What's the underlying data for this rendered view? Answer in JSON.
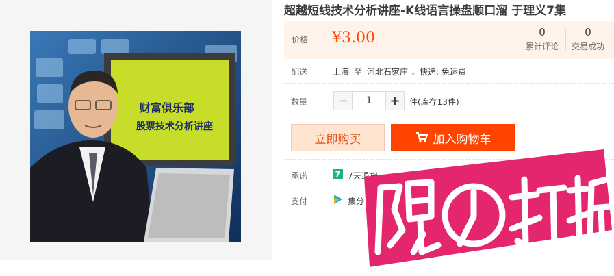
{
  "product": {
    "title": "超越短线技术分析讲座-K线语言操盘顺口溜 于理义7集",
    "image_board_line1": "财富俱乐部",
    "image_board_line2": "股票技术分析讲座"
  },
  "price": {
    "label": "价格",
    "value": "¥3.00"
  },
  "stats": {
    "reviews_count": "0",
    "reviews_label": "累计评论",
    "sales_count": "0",
    "sales_label": "交易成功"
  },
  "shipping": {
    "label": "配送",
    "origin": "上海",
    "to": "至",
    "destination": "河北石家庄",
    "express": "快递: 免运费"
  },
  "quantity": {
    "label": "数量",
    "minus": "−",
    "value": "1",
    "plus": "+",
    "stock": "件(库存13件)"
  },
  "actions": {
    "buy_now": "立即购买",
    "add_to_cart": "加入购物车"
  },
  "promise": {
    "label": "承诺",
    "icon_text": "7",
    "text": "7天退货"
  },
  "payment": {
    "label": "支付",
    "text": "集分"
  },
  "promo_overlay": {
    "text": "限时打折",
    "colors": {
      "bg": "#e4266e",
      "fg": "#ffffff"
    }
  },
  "colors": {
    "accent": "#ff4400",
    "price": "#ff4400",
    "price_bg": "#fff2e8"
  }
}
